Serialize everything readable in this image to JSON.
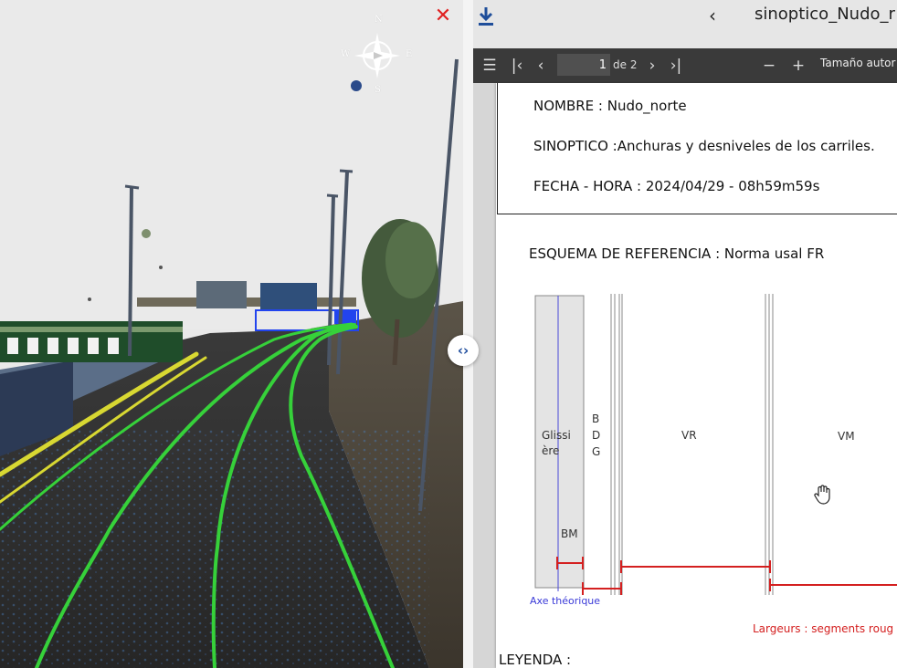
{
  "viewer3d": {
    "compass": {
      "n": "N",
      "s": "S",
      "e": "E",
      "w": "W"
    },
    "close_label": "✕",
    "toggle_label": "‹›"
  },
  "pdf": {
    "back_label": "‹",
    "filename": "sinoptico_Nudo_r",
    "toolbar": {
      "menu_icon": "☰",
      "first_icon": "|‹",
      "prev_icon": "‹",
      "current_page": "1",
      "page_of": "de 2",
      "next_icon": "›",
      "last_icon": "›|",
      "zoom_out": "−",
      "zoom_in": "+",
      "zoom_label": "Tamaño autor"
    },
    "header": {
      "nombre": "NOMBRE : Nudo_norte",
      "sinoptico": "SINOPTICO :Anchuras y desniveles de los carriles.",
      "fecha": "FECHA - HORA : 2024/04/29 - 08h59m59s"
    },
    "esquema": "ESQUEMA DE REFERENCIA : Norma usal FR",
    "diagram": {
      "glissiere_1": "Glissi",
      "glissiere_2": "ère",
      "bdg": [
        "B",
        "D",
        "G"
      ],
      "vr": "VR",
      "vm": "VM",
      "bm": "BM",
      "axe": "Axe théorique",
      "largeurs": "Largeurs : segments roug"
    },
    "leyenda": "LEYENDA :"
  },
  "colors": {
    "accent_red": "#e02020",
    "toolbar_bg": "#3a3a3a",
    "lane_green": "#36d13a",
    "lane_yellow": "#d8d832",
    "axis_blue": "#3a3ad8",
    "segment_red": "#d42020"
  }
}
